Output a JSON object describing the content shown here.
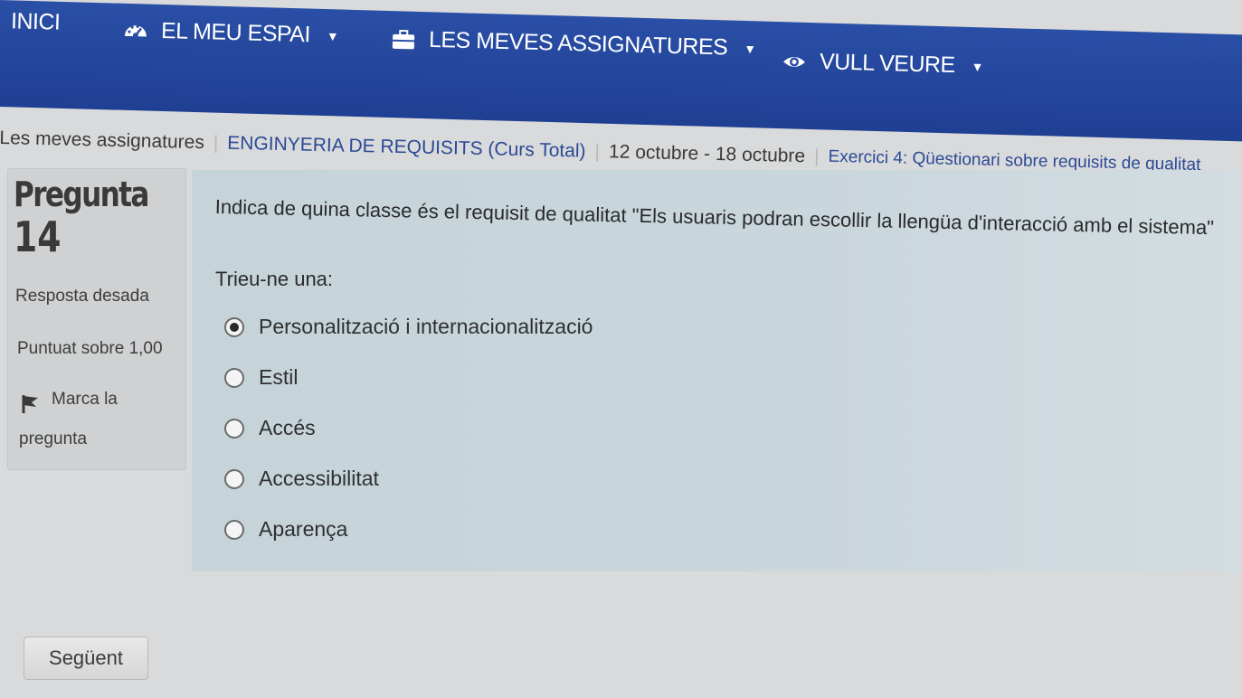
{
  "nav": {
    "home": "INICI",
    "my_space": "EL MEU ESPAI",
    "my_subjects": "LES MEVES ASSIGNATURES",
    "want_to_see": "VULL VEURE"
  },
  "breadcrumb": {
    "items": [
      "Les meves assignatures",
      "ENGINYERIA DE REQUISITS (Curs Total)",
      "12 octubre - 18 octubre",
      "Exercici 4: Qüestionari sobre requisits de qualitat"
    ]
  },
  "info": {
    "question_label": "Pregunta",
    "question_number": "14",
    "status": "Resposta desada",
    "score": "Puntuat sobre 1,00",
    "flag_line1": "Marca la",
    "flag_line2": "pregunta"
  },
  "question": {
    "text": "Indica de quina classe és el requisit de qualitat \"Els usuaris podran escollir la llengüa d'interacció amb el sistema\"",
    "prompt": "Trieu-ne una:",
    "options": [
      "Personalització i internacionalització",
      "Estil",
      "Accés",
      "Accessibilitat",
      "Aparença"
    ],
    "selected": "Personalització i internacionalització"
  },
  "footer": {
    "next_label": "Següent"
  },
  "colors": {
    "nav_bg": "#2a4fa6",
    "panel_bg": "#c6d4da",
    "info_bg": "#cfd1d2"
  }
}
